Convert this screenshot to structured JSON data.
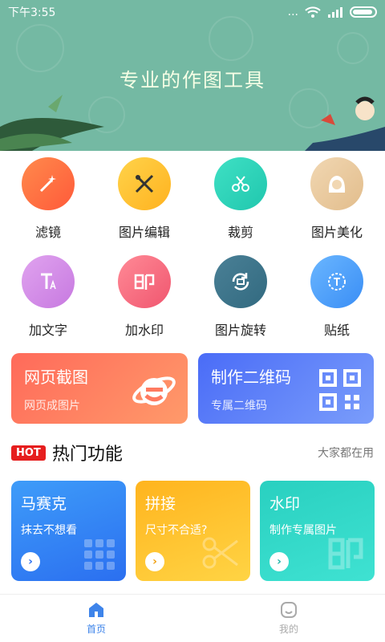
{
  "status_bar": {
    "time": "下午3:55",
    "signal_dots": "..."
  },
  "banner": {
    "title": "专业的作图工具"
  },
  "tools": [
    {
      "label": "滤镜",
      "icon": "magic-wand-icon",
      "color_from": "#ff8a4c",
      "color_to": "#ff5a3a"
    },
    {
      "label": "图片编辑",
      "icon": "tools-icon",
      "color_from": "#ffd34a",
      "color_to": "#ffb21f"
    },
    {
      "label": "裁剪",
      "icon": "scissors-icon",
      "color_from": "#3fe0c4",
      "color_to": "#20c7ae"
    },
    {
      "label": "图片美化",
      "icon": "face-icon",
      "color_from": "#f1d7b2",
      "color_to": "#e2bd8c"
    },
    {
      "label": "加文字",
      "icon": "text-icon",
      "color_from": "#e0a3ef",
      "color_to": "#c779e0"
    },
    {
      "label": "加水印",
      "icon": "watermark-icon",
      "color_from": "#ff8a96",
      "color_to": "#f0566f"
    },
    {
      "label": "图片旋转",
      "icon": "rotate-icon",
      "color_from": "#4a8096",
      "color_to": "#326a80"
    },
    {
      "label": "贴纸",
      "icon": "sticker-icon",
      "color_from": "#6ab6ff",
      "color_to": "#3a8ef5"
    }
  ],
  "features": [
    {
      "title": "网页截图",
      "subtitle": "网页成图片",
      "icon": "ie-browser-icon",
      "color_from": "#ff6a5a",
      "color_to": "#ff9a6a"
    },
    {
      "title": "制作二维码",
      "subtitle": "专属二维码",
      "icon": "qrcode-icon",
      "color_from": "#4a6cf7",
      "color_to": "#7a9dfb"
    }
  ],
  "hot": {
    "badge": "HOT",
    "title": "热门功能",
    "more": "大家都在用"
  },
  "hot_cards": [
    {
      "title": "马赛克",
      "subtitle": "抹去不想看",
      "icon": "mosaic-grid-icon",
      "color_from": "#3e9cf9",
      "color_to": "#2b6ff0",
      "arrow_color": "#2b6ff0"
    },
    {
      "title": "拼接",
      "subtitle": "尺寸不合适?",
      "icon": "scissors-icon",
      "color_from": "#ffb41e",
      "color_to": "#ffd444",
      "arrow_color": "#f0a010"
    },
    {
      "title": "水印",
      "subtitle": "制作专属图片",
      "icon": "watermark-icon",
      "color_from": "#29d0c0",
      "color_to": "#3fe2d2",
      "arrow_color": "#1fb5a8"
    }
  ],
  "nav": [
    {
      "label": "首页",
      "icon": "home-icon",
      "active": true
    },
    {
      "label": "我的",
      "icon": "profile-icon",
      "active": false
    }
  ]
}
